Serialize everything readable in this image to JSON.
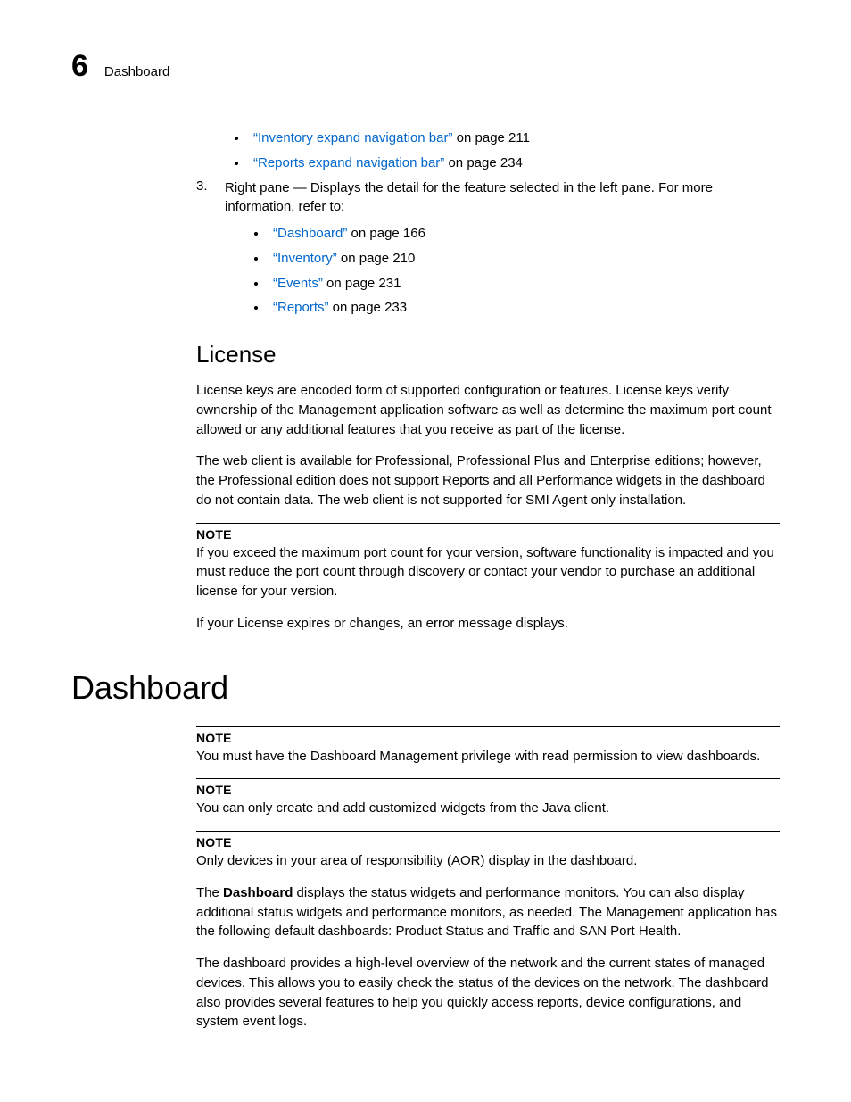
{
  "header": {
    "chapter_num": "6",
    "title": "Dashboard"
  },
  "top_bullets": [
    {
      "link": "“Inventory expand navigation bar”",
      "suffix": " on page 211"
    },
    {
      "link": "“Reports expand navigation bar”",
      "suffix": " on page 234"
    }
  ],
  "step3": {
    "number": "3.",
    "text": "Right pane — Displays the detail for the feature selected in the left pane. For more information, refer to:",
    "bullets": [
      {
        "link": "“Dashboard”",
        "suffix": " on page 166"
      },
      {
        "link": "“Inventory”",
        "suffix": " on page 210"
      },
      {
        "link": "“Events”",
        "suffix": " on page 231"
      },
      {
        "link": "“Reports”",
        "suffix": " on page 233"
      }
    ]
  },
  "license": {
    "heading": "License",
    "p1": "License keys are encoded form of supported configuration or features. License keys verify ownership of the Management application software as well as determine the maximum port count allowed or any additional features that you receive as part of the license.",
    "p2": "The web client is available for Professional, Professional Plus and Enterprise editions; however, the Professional edition does not support Reports and all Performance widgets in the dashboard do not contain data. The web client is not supported for SMI Agent only installation.",
    "note_label": "NOTE",
    "note_text": "If you exceed the maximum port count for your version, software functionality is impacted and you must reduce the port count through discovery or contact your vendor to purchase an additional license for your version.",
    "p3": "If your License expires or changes, an error message displays."
  },
  "dashboard": {
    "heading": "Dashboard",
    "note1_label": "NOTE",
    "note1_text": "You must have the Dashboard Management privilege with read permission to view dashboards.",
    "note2_label": "NOTE",
    "note2_text": "You can only create and add customized widgets from the Java client.",
    "note3_label": "NOTE",
    "note3_text": "Only devices in your area of responsibility (AOR) display in the dashboard.",
    "p1_prefix": "The ",
    "p1_bold": "Dashboard",
    "p1_suffix": " displays the status widgets and performance monitors. You can also display additional status widgets and performance monitors, as needed. The Management application has the following default dashboards: Product Status and Traffic and SAN Port Health.",
    "p2": "The dashboard provides a high-level overview of the network and the current states of managed devices. This allows you to easily check the status of the devices on the network. The dashboard also provides several features to help you quickly access reports, device configurations, and system event logs."
  }
}
